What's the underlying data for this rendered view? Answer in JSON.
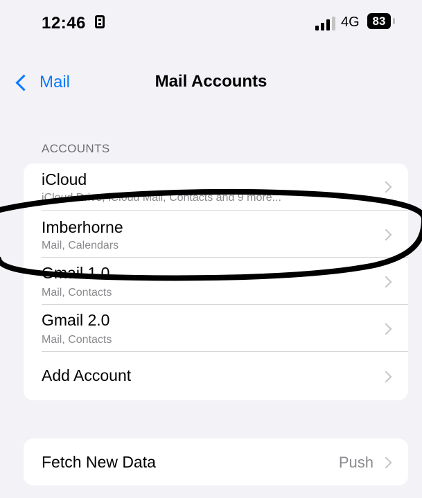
{
  "status_bar": {
    "time": "12:46",
    "network": "4G",
    "battery": "83"
  },
  "nav": {
    "back_label": "Mail",
    "title": "Mail Accounts"
  },
  "accounts_section": {
    "header": "ACCOUNTS",
    "items": [
      {
        "title": "iCloud",
        "subtitle": "iCloud Drive, iCloud Mail, Contacts and 9 more..."
      },
      {
        "title": "Imberhorne",
        "subtitle": "Mail, Calendars"
      },
      {
        "title": "Gmail 1.0",
        "subtitle": "Mail, Contacts"
      },
      {
        "title": "Gmail 2.0",
        "subtitle": "Mail, Contacts"
      }
    ],
    "add_account": "Add Account"
  },
  "fetch": {
    "label": "Fetch New Data",
    "value": "Push"
  },
  "colors": {
    "accent": "#0a7aff",
    "background": "#f2f2f7",
    "annotation": "#000000"
  }
}
